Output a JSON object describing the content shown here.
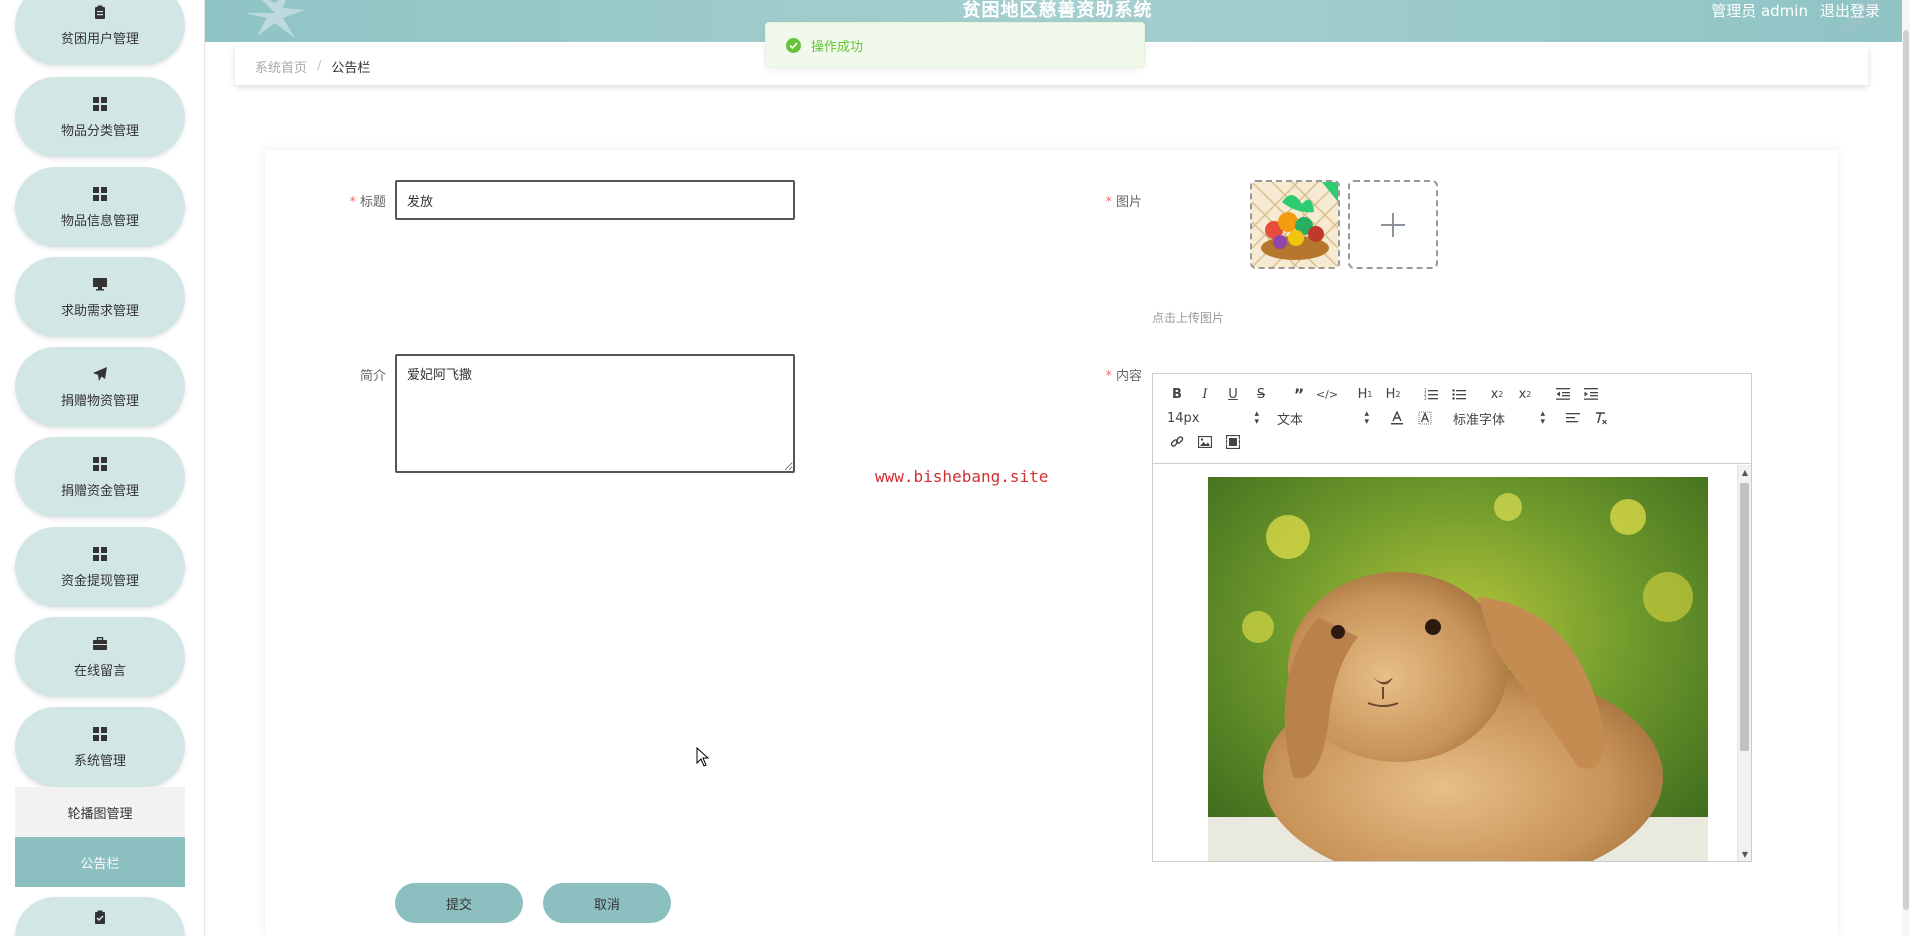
{
  "app": {
    "title": "贫困地区慈善资助系统",
    "user_label": "管理员 admin",
    "logout_label": "退出登录"
  },
  "colors": {
    "accent": "#8cbfbf",
    "pill_bg": "#d3e6e6",
    "required": "#f56c6c",
    "success": "#67c23a"
  },
  "sidebar": {
    "items": [
      {
        "label": "贫困用户管理",
        "icon": "clipboard-icon"
      },
      {
        "label": "物品分类管理",
        "icon": "grid-icon"
      },
      {
        "label": "物品信息管理",
        "icon": "grid-icon"
      },
      {
        "label": "求助需求管理",
        "icon": "monitor-icon"
      },
      {
        "label": "捐赠物资管理",
        "icon": "paper-plane-icon"
      },
      {
        "label": "捐赠资金管理",
        "icon": "grid-icon"
      },
      {
        "label": "资金提现管理",
        "icon": "grid-icon"
      },
      {
        "label": "在线留言",
        "icon": "briefcase-icon"
      },
      {
        "label": "系统管理",
        "icon": "grid-icon"
      }
    ],
    "sub_items": [
      {
        "label": "轮播图管理"
      },
      {
        "label": "公告栏"
      }
    ],
    "bottom_icon": "clipboard-check-icon"
  },
  "toast": {
    "message": "操作成功"
  },
  "breadcrumb": {
    "home": "系统首页",
    "current": "公告栏"
  },
  "form": {
    "title_label": "标题",
    "title_value": "发放",
    "intro_label": "简介",
    "intro_value": "爱妃阿飞撒",
    "image_label": "图片",
    "upload_hint": "点击上传图片",
    "content_label": "内容",
    "submit_label": "提交",
    "cancel_label": "取消"
  },
  "editor": {
    "font_size": "14px",
    "header_select": "文本",
    "font_family": "标准字体"
  },
  "watermark": "www.bishebang.site"
}
